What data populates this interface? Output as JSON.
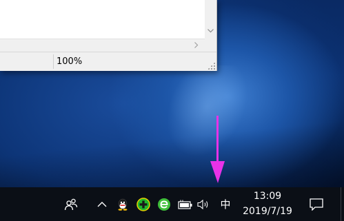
{
  "window": {
    "status_bar": {
      "zoom": "100%"
    }
  },
  "annotation": {
    "color": "#e832e8"
  },
  "taskbar": {
    "ime_label": "中",
    "clock": {
      "time": "13:09",
      "date": "2019/7/19"
    },
    "tray_icons": [
      "people-icon",
      "chevron-up-icon",
      "qq-icon",
      "security-plus-icon",
      "browser-e-icon",
      "battery-icon",
      "volume-icon",
      "action-center-icon"
    ]
  }
}
